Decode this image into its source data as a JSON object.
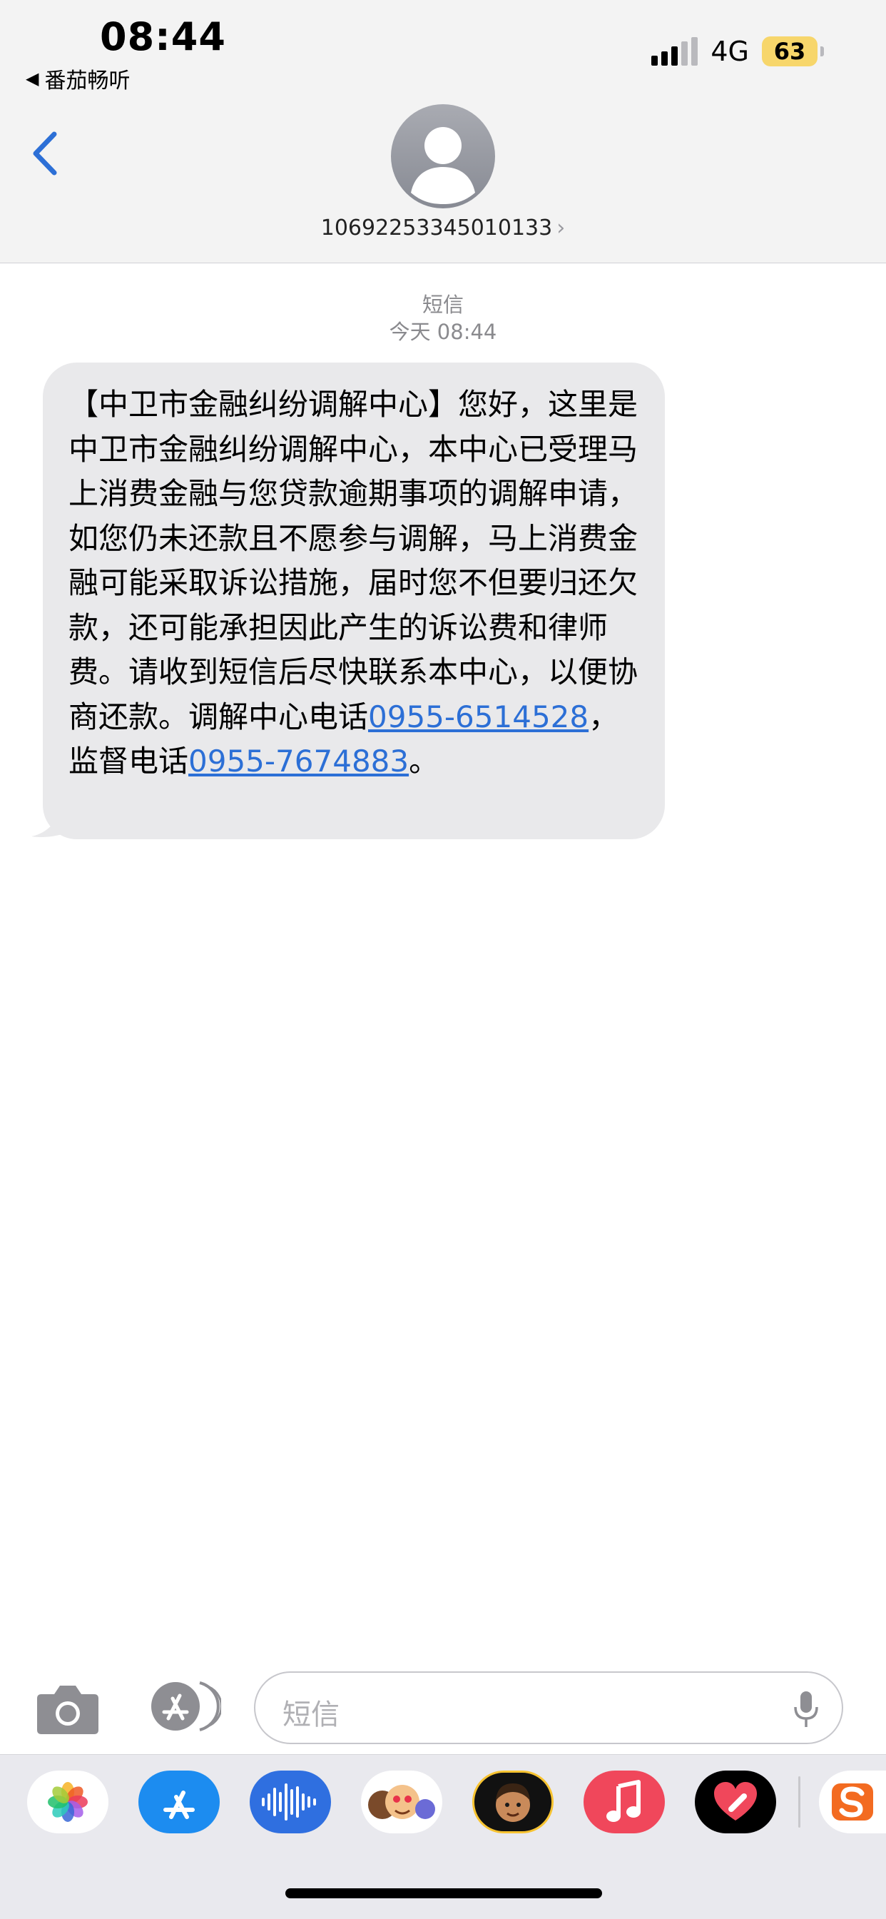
{
  "status_bar": {
    "time": "08:44",
    "back_app_label": "番茄畅听",
    "network": "4G",
    "battery": "63"
  },
  "header": {
    "contact_number": "10692253345010133",
    "chevron": "›"
  },
  "conversation": {
    "service_label": "短信",
    "timestamp": "今天 08:44",
    "message": {
      "text_part1": "【中卫市金融纠纷调解中心】您好，这里是中卫市金融纠纷调解中心，本中心已受理马上消费金融与您贷款逾期事项的调解申请，如您仍未还款且不愿参与调解，马上消费金融可能采取诉讼措施，届时您不但要归还欠款，还可能承担因此产生的诉讼费和律师费。请收到短信后尽快联系本中心，以便协商还款。调解中心电话",
      "phone1": "0955-6514528",
      "text_part2": "，监督电话",
      "phone2": "0955-7674883",
      "text_part3": "。"
    }
  },
  "composer": {
    "placeholder": "短信"
  },
  "icons": {
    "back": "chevron-left-icon",
    "avatar": "person-icon",
    "camera": "camera-icon",
    "app_store": "app-store-icon",
    "mic": "microphone-icon"
  },
  "app_strip": {
    "apps": [
      "photos",
      "app-store",
      "audio-messages",
      "memoji-stickers",
      "memoji",
      "music",
      "digital-touch",
      "sogou-keyboard"
    ]
  },
  "colors": {
    "accent": "#2c6fd6",
    "bubble": "#e9e9eb",
    "header_bg": "#f3f3f3",
    "battery": "#f7d66b"
  }
}
